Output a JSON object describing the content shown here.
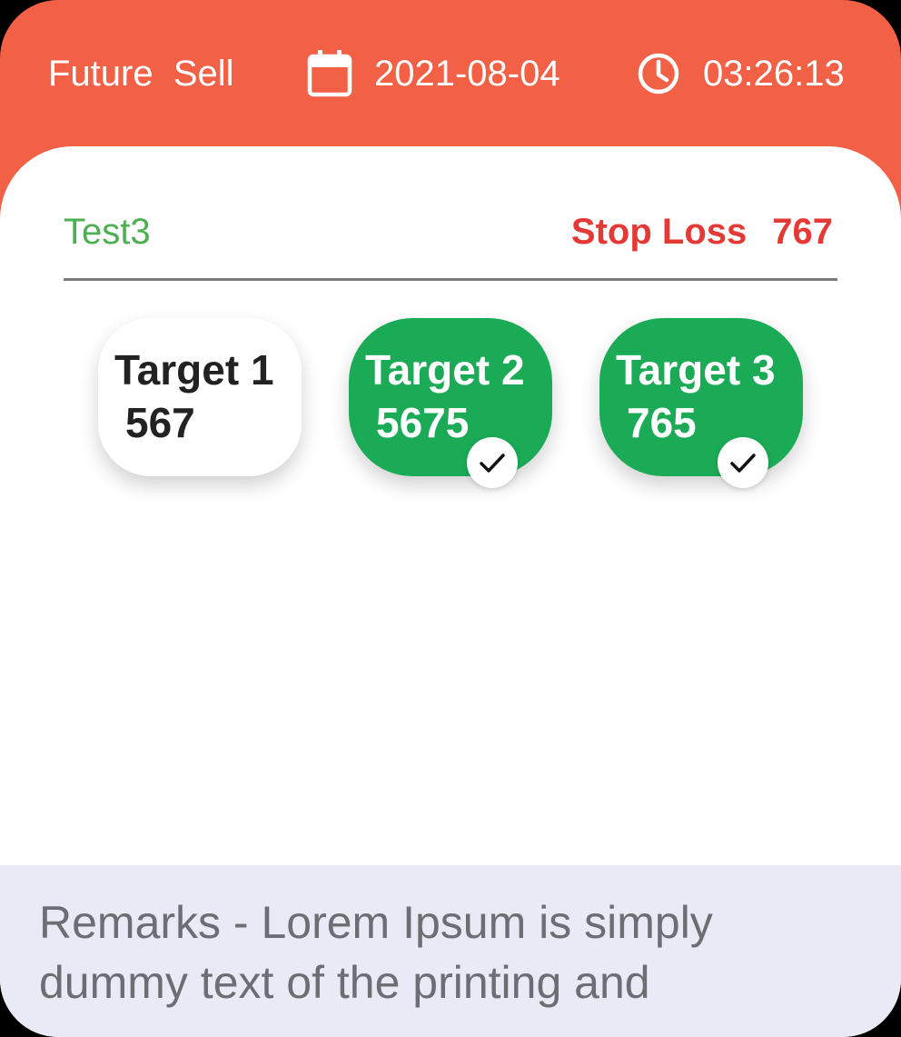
{
  "header": {
    "trade_type": "Future  Sell",
    "date": "2021-08-04",
    "time": "03:26:13",
    "calendar_icon": "calendar-icon",
    "clock_icon": "clock-icon"
  },
  "trade": {
    "name": "Test3",
    "stop_loss_label": "Stop Loss",
    "stop_loss_value": "767"
  },
  "targets": [
    {
      "label": "Target 1",
      "value": "567",
      "achieved": false
    },
    {
      "label": "Target 2",
      "value": "5675",
      "achieved": true
    },
    {
      "label": "Target 3",
      "value": "765",
      "achieved": true
    }
  ],
  "remarks": {
    "text": "Remarks - Lorem Ipsum is simply dummy text of the printing and"
  },
  "colors": {
    "header_bg": "#F26046",
    "name_text": "#4CAF50",
    "stop_loss_text": "#E53935",
    "target_achieved_bg": "#1BAA55",
    "remarks_bg": "#E8EAF6"
  }
}
